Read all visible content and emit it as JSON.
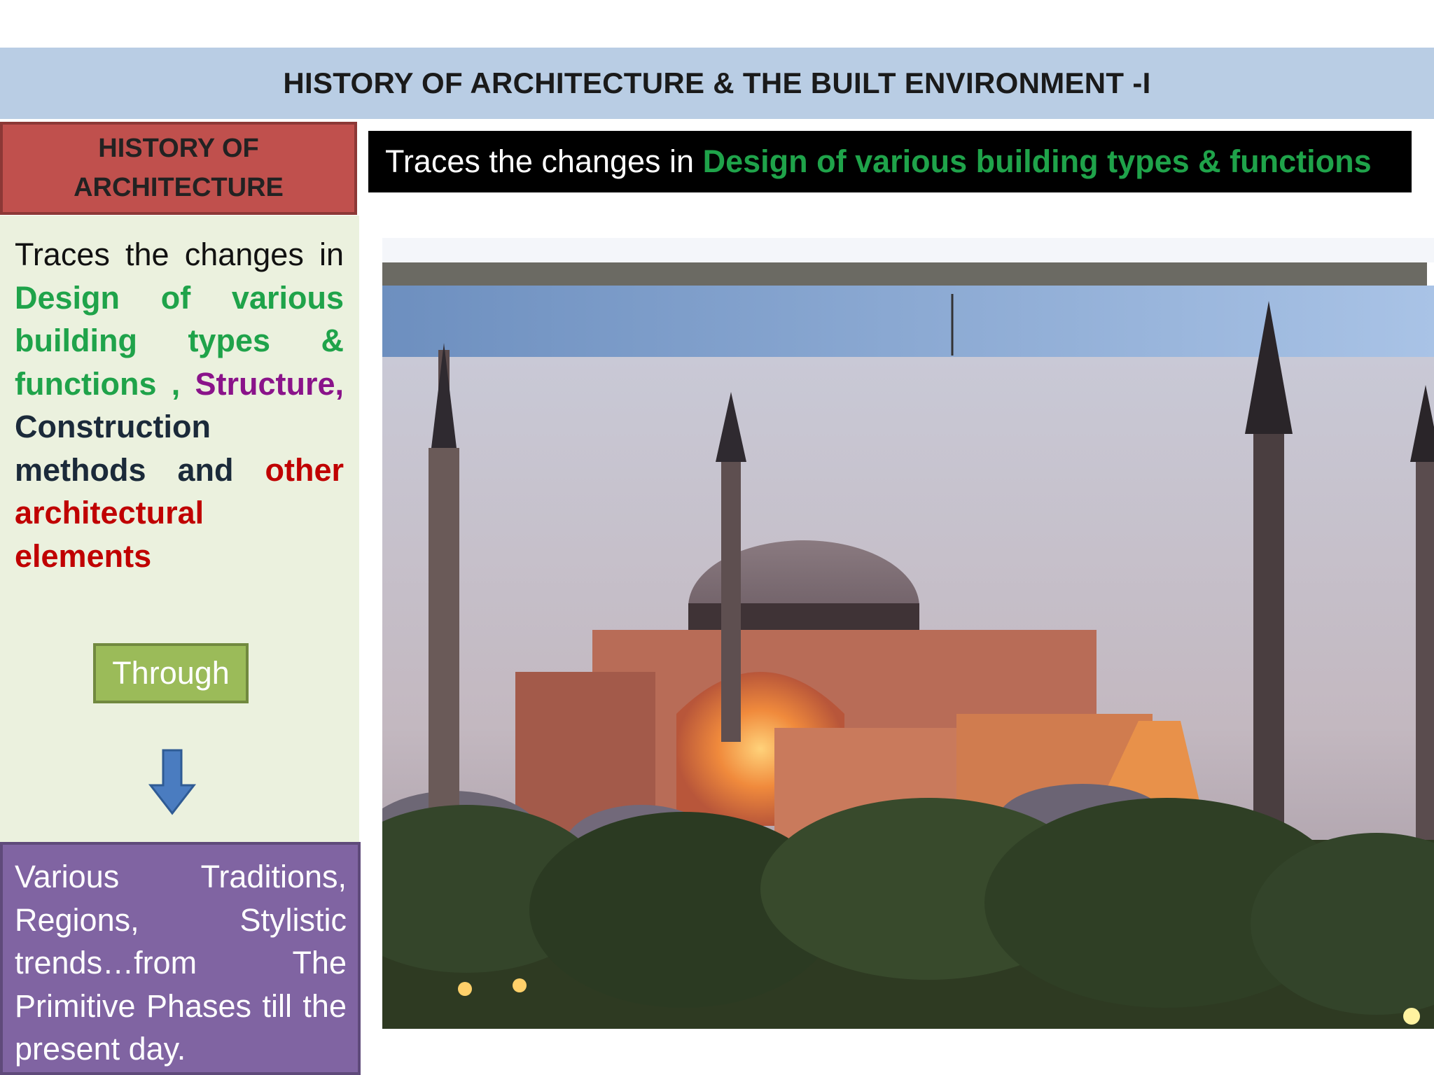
{
  "header": {
    "title": "HISTORY OF ARCHITECTURE & THE BUILT ENVIRONMENT -I"
  },
  "sidebar": {
    "heading": "HISTORY OF\nARCHITECTURE",
    "description": {
      "part1": "Traces the changes in ",
      "part2": "Design of various building types & functions , ",
      "part3": "Structure,",
      "part4": " Construction methods and ",
      "part5": "other architectural elements"
    },
    "through_label": "Through",
    "arrow_icon": "down-arrow-icon",
    "footer_text": "Various Traditions, Regions, Stylistic trends…from The Primitive Phases till the present day."
  },
  "main": {
    "banner_prefix": "Traces the changes in ",
    "banner_highlight": "Design of various building types & functions"
  },
  "colors": {
    "header_bg": "#b9cde4",
    "heading_box": "#c0504d",
    "panel_bg": "#ebf1de",
    "green_text": "#1fa34a",
    "purple_text": "#8a138a",
    "red_text": "#c00000",
    "through_box": "#9bbb59",
    "footer_box": "#8064a2",
    "arrow": "#4a7cc0"
  }
}
